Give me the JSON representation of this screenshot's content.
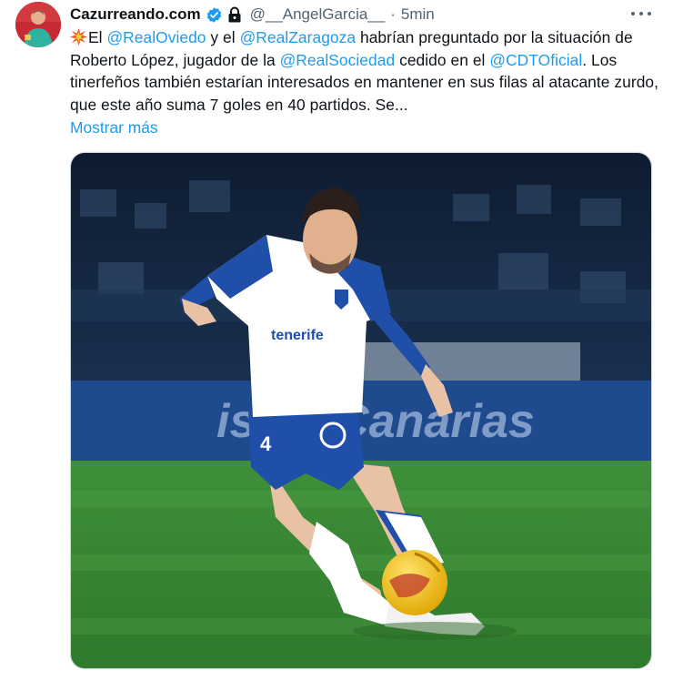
{
  "tweet": {
    "display_name": "Cazurreando.com",
    "handle": "@__AngelGarcia__",
    "separator": "·",
    "time": "5min",
    "icons": {
      "verified": "verified-badge-icon",
      "lock": "lock-icon",
      "more": "more-options-icon",
      "emoji": "collision-emoji-icon"
    },
    "text": {
      "p1": "El ",
      "m1": "@RealOviedo",
      "p2": " y el ",
      "m2": "@RealZaragoza",
      "p3": " habrían preguntado por la situación de Roberto López, jugador de la ",
      "m3": "@RealSociedad",
      "p4": " cedido en el ",
      "m4": "@CDTOficial",
      "p5": ". Los tinerfeños también estarían interesados en mantener en sus filas al atacante zurdo, que este año suma 7 goles en 40 partidos. Se..."
    },
    "show_more": "Mostrar más",
    "photo": {
      "sponsor": "tenerife",
      "number": "4",
      "board_text": "islas Canarias"
    },
    "colors": {
      "link": "#1d9bf0",
      "text": "#0f1419",
      "muted": "#536471",
      "verified": "#1d9bf0"
    }
  }
}
